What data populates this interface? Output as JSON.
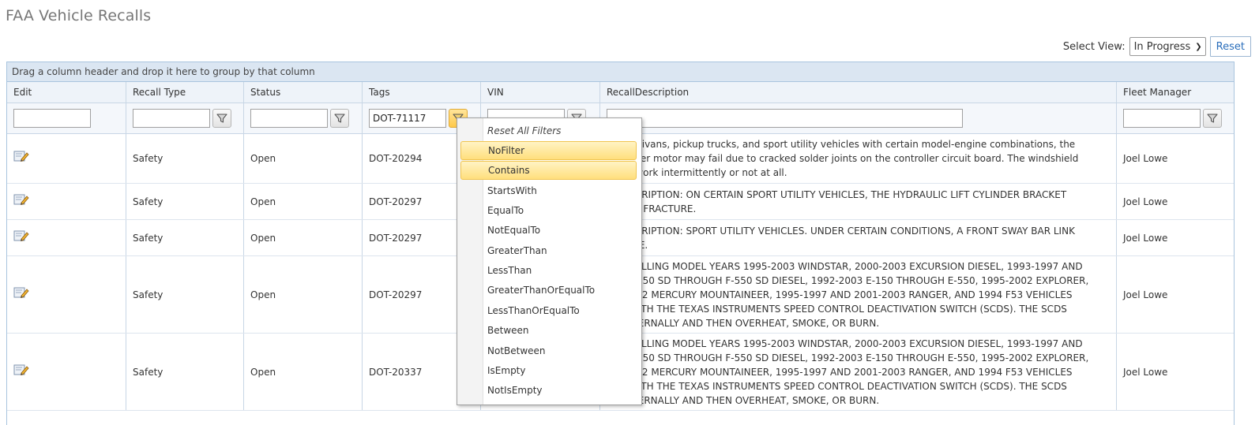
{
  "page": {
    "title": "FAA Vehicle Recalls"
  },
  "view": {
    "label": "Select View:",
    "selected": "In Progress",
    "reset_label": "Reset"
  },
  "grid": {
    "group_hint": "Drag a column header and drop it here to group by that column",
    "columns": [
      "Edit",
      "Recall Type",
      "Status",
      "Tags",
      "VIN",
      "RecallDescription",
      "Fleet Manager"
    ],
    "filters": {
      "tags_value": "DOT-71117"
    },
    "rows": [
      {
        "type": "Safety",
        "status": "Open",
        "tags": "DOT-20294",
        "description": "ain minivans, pickup trucks, and sport utility vehicles with certain model-engine combinations, the\neld wiper motor may fail due to cracked solder joints on the controller circuit board. The windshield\ncould work intermittently or not at all.",
        "fleet": "Joel Lowe"
      },
      {
        "type": "Safety",
        "status": "Open",
        "tags": "DOT-20297",
        "description": "E DESCRIPTION: ON CERTAIN SPORT UTILITY VEHICLES, THE HYDRAULIC LIFT CYLINDER BRACKET\nCOULD FRACTURE.",
        "fleet": "Joel Lowe"
      },
      {
        "type": "Safety",
        "status": "Open",
        "tags": "DOT-20297",
        "description": "E DESCRIPTION: SPORT UTILITY VEHICLES. UNDER CERTAIN CONDITIONS, A FRONT SWAY BAR LINK\nACTURE.",
        "fleet": "Joel Lowe"
      },
      {
        "type": "Safety",
        "status": "Open",
        "tags": "DOT-20297",
        "description": "S RECALLING MODEL YEARS 1995-2003 WINDSTAR, 2000-2003 EXCURSION DIESEL, 1993-1997 AND\n003 F-250 SD THROUGH F-550 SD DIESEL, 1992-2003 E-150 THROUGH E-550, 1995-2002 EXPLORER,\nND 2002 MERCURY MOUNTAINEER, 1995-1997 AND 2001-2003 RANGER, AND 1994 F53 VEHICLES\nPED WITH THE TEXAS INSTRUMENTS SPEED CONTROL DEACTIVATION SWITCH (SCDS). THE SCDS\nAK INTERNALLY AND THEN OVERHEAT, SMOKE, OR BURN.",
        "fleet": "Joel Lowe"
      },
      {
        "type": "Safety",
        "status": "Open",
        "tags": "DOT-20337",
        "description": "S RECALLING MODEL YEARS 1995-2003 WINDSTAR, 2000-2003 EXCURSION DIESEL, 1993-1997 AND\n003 F-250 SD THROUGH F-550 SD DIESEL, 1992-2003 E-150 THROUGH E-550, 1995-2002 EXPLORER,\nND 2002 MERCURY MOUNTAINEER, 1995-1997 AND 2001-2003 RANGER, AND 1994 F53 VEHICLES\nPED WITH THE TEXAS INSTRUMENTS SPEED CONTROL DEACTIVATION SWITCH (SCDS). THE SCDS\nAK INTERNALLY AND THEN OVERHEAT, SMOKE, OR BURN.",
        "fleet": "Joel Lowe"
      }
    ]
  },
  "filter_menu": {
    "reset_label": "Reset All Filters",
    "options": [
      "NoFilter",
      "Contains",
      "StartsWith",
      "EqualTo",
      "NotEqualTo",
      "GreaterThan",
      "LessThan",
      "GreaterThanOrEqualTo",
      "LessThanOrEqualTo",
      "Between",
      "NotBetween",
      "IsEmpty",
      "NotIsEmpty"
    ],
    "highlighted": [
      "NoFilter",
      "Contains"
    ]
  },
  "icons": {
    "edit": "edit-pencil-icon",
    "filter": "funnel-filter-icon",
    "dropdown": "chevron-down-icon"
  },
  "colors": {
    "header_bg": "#dbe6f2",
    "border": "#a9c4de",
    "highlight": "#ffdf7d",
    "link": "#2a6ebb"
  }
}
